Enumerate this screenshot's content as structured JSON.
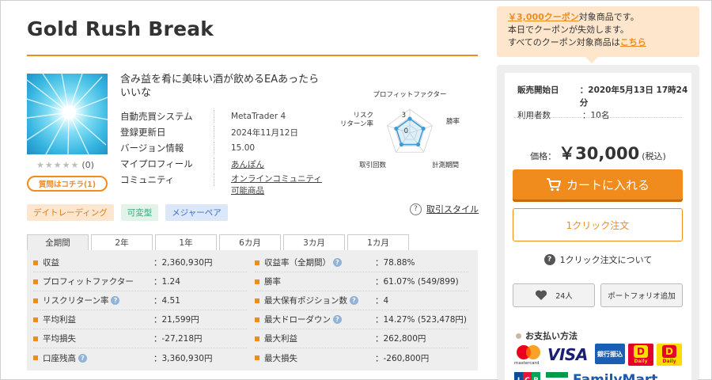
{
  "product": {
    "title": "Gold Rush Break",
    "catch_copy": "含み益を肴に美味い酒が飲めるEAあったらいいな",
    "rating_stars": "★★★★★",
    "rating_count": "(0)",
    "question_button": "質問はコチラ(1)"
  },
  "info": [
    {
      "key": "自動売買システム",
      "value": "MetaTrader 4"
    },
    {
      "key": "登録更新日",
      "value": "2024年11月12日"
    },
    {
      "key": "バージョン情報",
      "value": "15.00"
    },
    {
      "key": "マイプロフィール",
      "value": "あんぽん"
    },
    {
      "key": "コミュニティ",
      "value": "オンラインコミュニティ可能商品"
    }
  ],
  "radar": {
    "axes": [
      "プロフィットファクター",
      "勝率",
      "計測期間",
      "取引回数",
      "リスクリターン率"
    ],
    "scale_max": "3",
    "scale_min": "0",
    "values": [
      1,
      1,
      1,
      1,
      1
    ]
  },
  "tags": [
    "デイトレーディング",
    "可変型",
    "メジャーペア"
  ],
  "trade_style_link": "取引スタイル",
  "tabs": [
    "全期間",
    "2年",
    "1年",
    "6カ月",
    "3カ月",
    "1カ月"
  ],
  "stats_left": [
    {
      "label": "収益",
      "value": "：2,360,930円",
      "help": false
    },
    {
      "label": "プロフィットファクター",
      "value": "：1.24",
      "help": false
    },
    {
      "label": "リスクリターン率",
      "value": "：4.51",
      "help": true
    },
    {
      "label": "平均利益",
      "value": "：21,599円",
      "help": false
    },
    {
      "label": "平均損失",
      "value": "：-27,218円",
      "help": false
    },
    {
      "label": "口座残高",
      "value": "：3,360,930円",
      "help": true
    }
  ],
  "stats_right": [
    {
      "label": "収益率（全期間）",
      "value": "：78.88%",
      "help": true
    },
    {
      "label": "勝率",
      "value": "：61.07% (549/899)",
      "help": false
    },
    {
      "label": "最大保有ポジション数",
      "value": "：4",
      "help": true
    },
    {
      "label": "最大ドローダウン",
      "value": "：14.27% (523,478円)",
      "help": true
    },
    {
      "label": "最大利益",
      "value": "：262,800円",
      "help": false
    },
    {
      "label": "最大損失",
      "value": "：-260,800円",
      "help": false
    }
  ],
  "coupon": {
    "highlight": "￥3,000クーポン",
    "line1_rest": "対象商品です。",
    "line2": "本日でクーポンが失効します。",
    "line3_prefix": "すべてのクーポン対象商品は",
    "line3_link": "こちら"
  },
  "purchase": {
    "sale_start_label": "販売開始日",
    "sale_start_value": "：2020年5月13日 17時24分",
    "users_label": "利用者数",
    "users_value": "：10名",
    "price_label": "価格：",
    "price_value": "￥30,000",
    "price_tax": "(税込)",
    "cart_button": "カートに入れる",
    "one_click_button": "1クリック注文",
    "one_click_about": "1クリック注文について",
    "favorite_count": "24人",
    "portfolio_button": "ポートフォリオ追加",
    "payment_title": "お支払い方法"
  },
  "payment_logos": {
    "mastercard": "mastercard",
    "visa": "VISA",
    "bank": "銀行振込",
    "daily": "Daily",
    "jcb": "JCB",
    "familymart": "FamilyMart"
  },
  "colors": {
    "accent": "#f08c1e",
    "panel_bg": "#eeeeee",
    "coupon_bg": "#fde6cc"
  }
}
